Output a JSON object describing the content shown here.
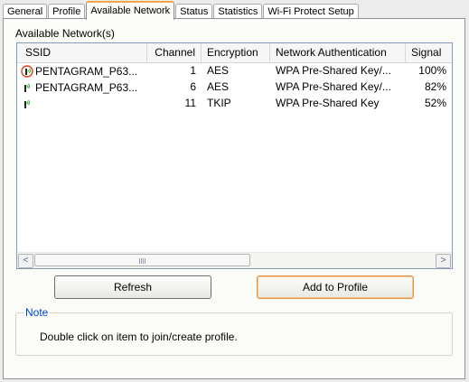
{
  "tabs": [
    {
      "label": "General"
    },
    {
      "label": "Profile"
    },
    {
      "label": "Available Network"
    },
    {
      "label": "Status"
    },
    {
      "label": "Statistics"
    },
    {
      "label": "Wi-Fi Protect Setup"
    }
  ],
  "active_tab": "Available Network",
  "section_label": "Available Network(s)",
  "columns": [
    "SSID",
    "Channel",
    "Encryption",
    "Network Authentication",
    "Signal"
  ],
  "networks": [
    {
      "ssid": "PENTAGRAM_P63...",
      "channel": "1",
      "encryption": "AES",
      "auth": "WPA Pre-Shared Key/...",
      "signal": "100%",
      "icon": "connected-wireless-signal-icon"
    },
    {
      "ssid": "PENTAGRAM_P63...",
      "channel": "6",
      "encryption": "AES",
      "auth": "WPA Pre-Shared Key/...",
      "signal": "82%",
      "icon": "wireless-signal-icon"
    },
    {
      "ssid": "",
      "channel": "11",
      "encryption": "TKIP",
      "auth": "WPA Pre-Shared Key",
      "signal": "52%",
      "icon": "wireless-signal-icon"
    }
  ],
  "scrollbar": {
    "left_arrow": "<",
    "right_arrow": ">"
  },
  "buttons": {
    "refresh": "Refresh",
    "add_to_profile": "Add to Profile"
  },
  "note": {
    "title": "Note",
    "text": "Double click on item to join/create profile."
  },
  "colors": {
    "active_tab_accent": "#f3a742",
    "note_title": "#0046d5",
    "signal_green": "#2db52d"
  }
}
